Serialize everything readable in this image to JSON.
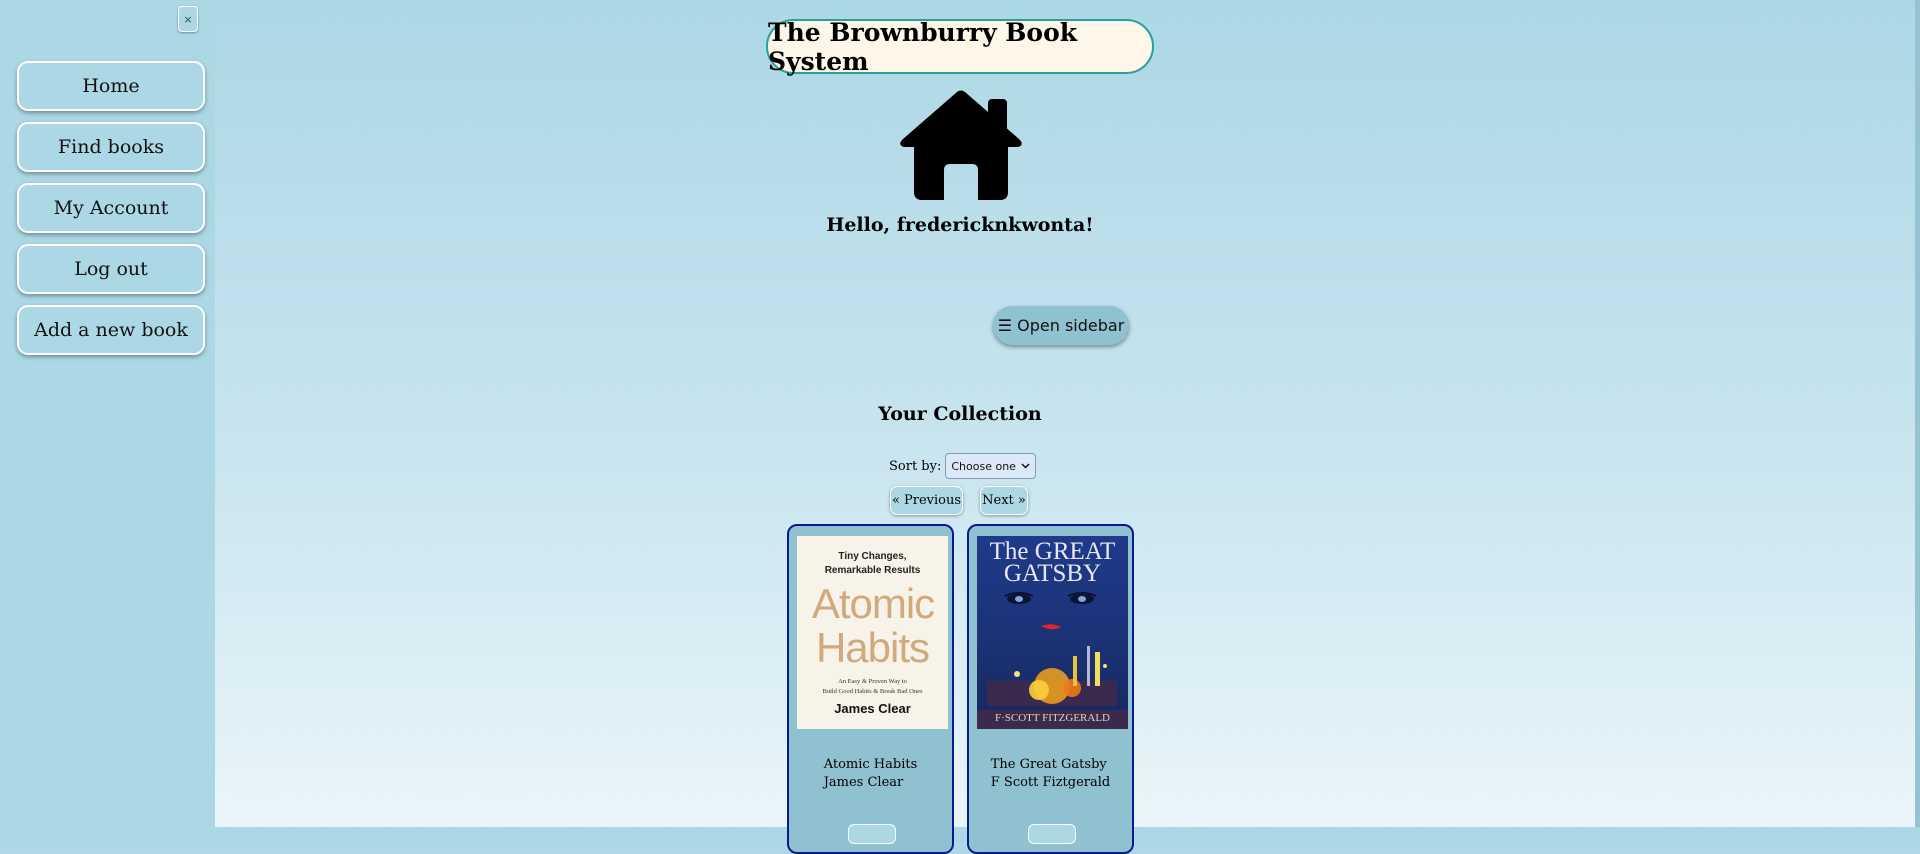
{
  "sidebar": {
    "close_label": "×",
    "items": [
      {
        "label": "Home"
      },
      {
        "label": "Find books"
      },
      {
        "label": "My Account"
      },
      {
        "label": "Log out"
      },
      {
        "label": "Add a new book"
      }
    ]
  },
  "header": {
    "title": "The Brownburry Book System",
    "greeting": "Hello, fredericknkwonta!"
  },
  "main": {
    "open_sidebar_label": "☰ Open sidebar",
    "collection_heading": "Your Collection",
    "sort_label": "Sort by:",
    "sort_selected": "Choose one",
    "prev_label": "« Previous",
    "next_label": "Next »",
    "books": [
      {
        "title": "Atomic Habits",
        "author": "James Clear",
        "cover": {
          "tagline": "Tiny Changes,\nRemarkable Results",
          "word1": "Atomic",
          "word2": "Habits",
          "subtitle1": "An Easy & Proven Way to",
          "subtitle2": "Build Good Habits & Break Bad Ones",
          "author": "James Clear"
        }
      },
      {
        "title": "The Great Gatsby",
        "author": "F Scott Fiztgerald",
        "cover": {
          "line1": "The GREAT",
          "line2": "GATSBY",
          "author": "F·SCOTT FITZGERALD"
        }
      }
    ]
  },
  "colors": {
    "background_top": "#acd7e5",
    "card_border": "#0b1a8a",
    "title_border": "#2aa197",
    "title_bg": "#fdf6e9"
  }
}
